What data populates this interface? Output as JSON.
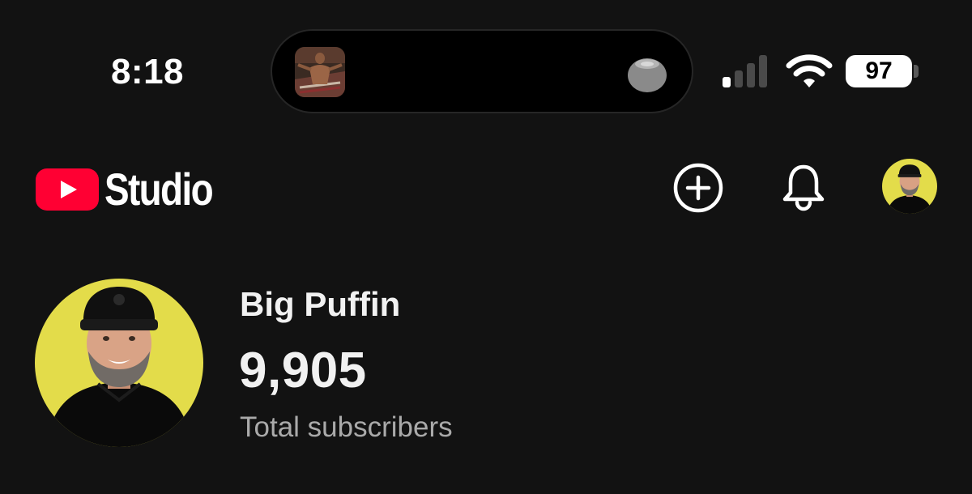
{
  "status_bar": {
    "time": "8:18",
    "battery_level": "97",
    "signal_bars_active": 1,
    "signal_bars_total": 4,
    "wifi_icon": "wifi-icon",
    "now_playing_icon": "album-art-thumbnail",
    "speaker_icon": "homepod-mini-icon"
  },
  "header": {
    "logo_text": "Studio",
    "logo_icon": "youtube-play-icon",
    "create_icon": "plus-circle-icon",
    "notifications_icon": "bell-icon",
    "account_icon": "avatar"
  },
  "channel": {
    "name": "Big Puffin",
    "subscriber_count": "9,905",
    "subscriber_label": "Total subscribers"
  },
  "colors": {
    "background": "#121212",
    "youtube_red": "#ff0033",
    "avatar_yellow": "#e3dc4a",
    "secondary_text": "#aaaaaa"
  }
}
